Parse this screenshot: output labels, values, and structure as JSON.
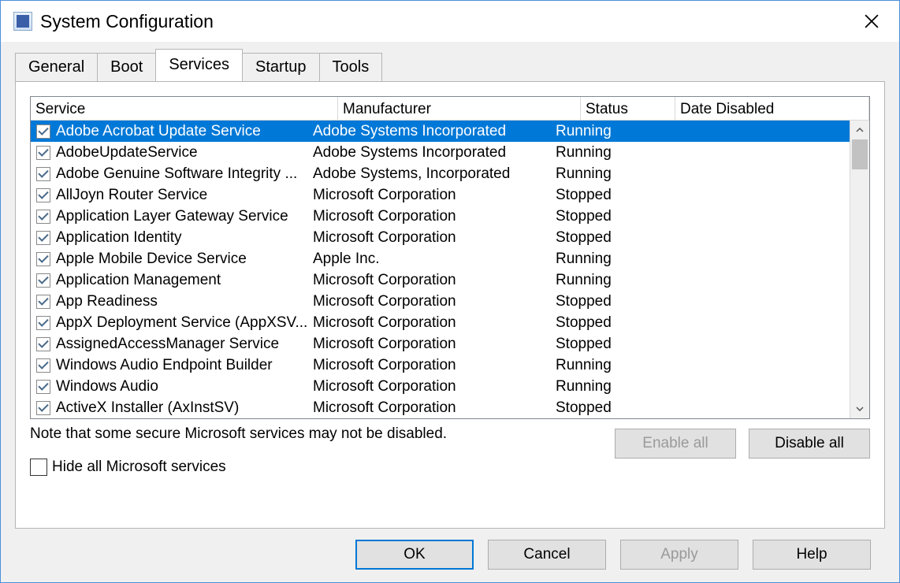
{
  "window": {
    "title": "System Configuration"
  },
  "tabs": [
    {
      "label": "General"
    },
    {
      "label": "Boot"
    },
    {
      "label": "Services"
    },
    {
      "label": "Startup"
    },
    {
      "label": "Tools"
    }
  ],
  "active_tab_index": 2,
  "columns": {
    "service": "Service",
    "manufacturer": "Manufacturer",
    "status": "Status",
    "date_disabled": "Date Disabled"
  },
  "services": [
    {
      "checked": true,
      "selected": true,
      "name": "Adobe Acrobat Update Service",
      "manufacturer": "Adobe Systems Incorporated",
      "status": "Running",
      "date_disabled": ""
    },
    {
      "checked": true,
      "selected": false,
      "name": "AdobeUpdateService",
      "manufacturer": "Adobe Systems Incorporated",
      "status": "Running",
      "date_disabled": ""
    },
    {
      "checked": true,
      "selected": false,
      "name": "Adobe Genuine Software Integrity ...",
      "manufacturer": "Adobe Systems, Incorporated",
      "status": "Running",
      "date_disabled": ""
    },
    {
      "checked": true,
      "selected": false,
      "name": "AllJoyn Router Service",
      "manufacturer": "Microsoft Corporation",
      "status": "Stopped",
      "date_disabled": ""
    },
    {
      "checked": true,
      "selected": false,
      "name": "Application Layer Gateway Service",
      "manufacturer": "Microsoft Corporation",
      "status": "Stopped",
      "date_disabled": ""
    },
    {
      "checked": true,
      "selected": false,
      "name": "Application Identity",
      "manufacturer": "Microsoft Corporation",
      "status": "Stopped",
      "date_disabled": ""
    },
    {
      "checked": true,
      "selected": false,
      "name": "Apple Mobile Device Service",
      "manufacturer": "Apple Inc.",
      "status": "Running",
      "date_disabled": ""
    },
    {
      "checked": true,
      "selected": false,
      "name": "Application Management",
      "manufacturer": "Microsoft Corporation",
      "status": "Running",
      "date_disabled": ""
    },
    {
      "checked": true,
      "selected": false,
      "name": "App Readiness",
      "manufacturer": "Microsoft Corporation",
      "status": "Stopped",
      "date_disabled": ""
    },
    {
      "checked": true,
      "selected": false,
      "name": "AppX Deployment Service (AppXSV...",
      "manufacturer": "Microsoft Corporation",
      "status": "Stopped",
      "date_disabled": ""
    },
    {
      "checked": true,
      "selected": false,
      "name": "AssignedAccessManager Service",
      "manufacturer": "Microsoft Corporation",
      "status": "Stopped",
      "date_disabled": ""
    },
    {
      "checked": true,
      "selected": false,
      "name": "Windows Audio Endpoint Builder",
      "manufacturer": "Microsoft Corporation",
      "status": "Running",
      "date_disabled": ""
    },
    {
      "checked": true,
      "selected": false,
      "name": "Windows Audio",
      "manufacturer": "Microsoft Corporation",
      "status": "Running",
      "date_disabled": ""
    },
    {
      "checked": true,
      "selected": false,
      "name": "ActiveX Installer (AxInstSV)",
      "manufacturer": "Microsoft Corporation",
      "status": "Stopped",
      "date_disabled": ""
    }
  ],
  "note": "Note that some secure Microsoft services may not be disabled.",
  "hide_checkbox": {
    "checked": false,
    "label": "Hide all Microsoft services"
  },
  "buttons": {
    "enable_all": "Enable all",
    "disable_all": "Disable all",
    "ok": "OK",
    "cancel": "Cancel",
    "apply": "Apply",
    "help": "Help"
  }
}
